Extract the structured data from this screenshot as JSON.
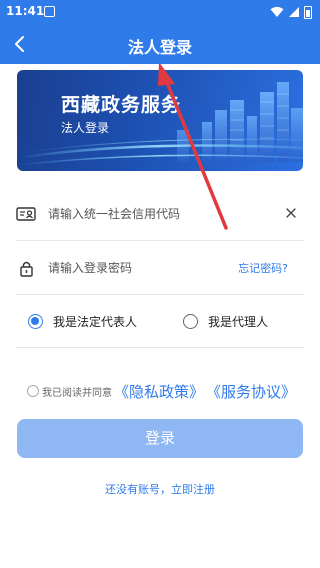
{
  "status_bar": {
    "time": "11:41"
  },
  "header": {
    "title": "法人登录",
    "back_icon": "chevron-left-icon"
  },
  "banner": {
    "title": "西藏政务服务",
    "subtitle": "法人登录"
  },
  "form": {
    "credit_code": {
      "placeholder": "请输入统一社会信用代码",
      "value": ""
    },
    "password": {
      "placeholder": "请输入登录密码",
      "value": ""
    },
    "forgot_password": "忘记密码?"
  },
  "roles": {
    "options": [
      {
        "label": "我是法定代表人",
        "selected": true
      },
      {
        "label": "我是代理人",
        "selected": false
      }
    ]
  },
  "agreement": {
    "text": "我已阅读并同意",
    "privacy_link": "《隐私政策》",
    "service_link": "《服务协议》",
    "checked": false
  },
  "actions": {
    "login": "登录",
    "register": "还没有账号，立即注册"
  },
  "colors": {
    "primary": "#2f7bea",
    "login_button_disabled": "#8fb7f3",
    "annotation_arrow": "#e0393e"
  }
}
